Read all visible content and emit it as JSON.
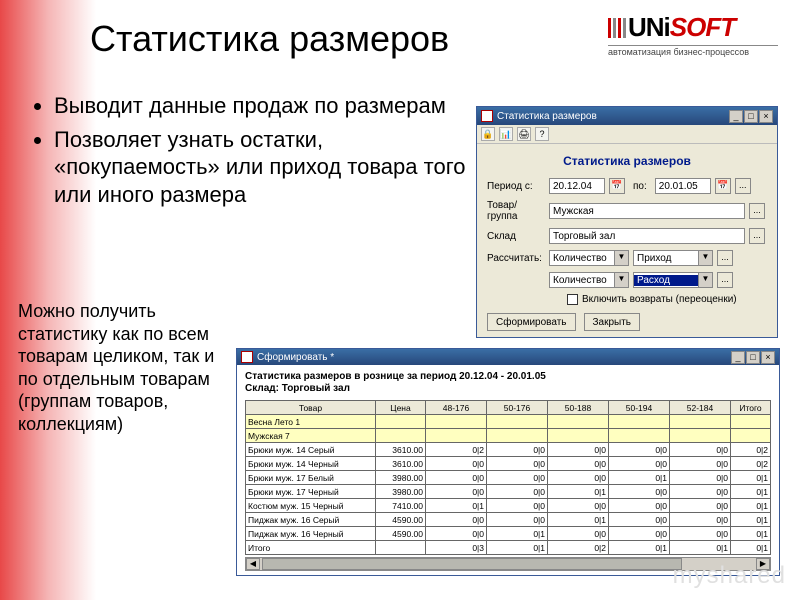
{
  "slide": {
    "title": "Статистика размеров",
    "bullets": [
      "Выводит данные продаж по размерам",
      "Позволяет узнать остатки, «покупаемость» или приход товара того или иного размера"
    ],
    "paragraph": "Можно получить статистику как по всем товарам целиком, так и по отдельным товарам (группам товаров, коллекциям)"
  },
  "logo": {
    "uni": "UNi",
    "soft": "SOFT",
    "sub": "автоматизация бизнес-процессов"
  },
  "watermark": "myshared",
  "dialog": {
    "title": "Статистика размеров",
    "heading": "Статистика размеров",
    "period_label": "Период с:",
    "date_from": "20.12.04",
    "to_label": "по:",
    "date_to": "20.01.05",
    "group_label": "Товар/группа",
    "group_value": "Мужская",
    "warehouse_label": "Склад",
    "warehouse_value": "Торговый зал",
    "calc_label": "Рассчитать:",
    "calc1": "Количество",
    "calc1b": "Приход",
    "calc2": "Количество",
    "calc2b": "Расход",
    "check_label": "Включить возвраты (переоценки)",
    "btn_form": "Сформировать",
    "btn_close": "Закрыть"
  },
  "result": {
    "title": "Сформировать *",
    "head1": "Статистика размеров в рознице за период 20.12.04 - 20.01.05",
    "head2": "Склад: Торговый зал",
    "columns": [
      "Товар",
      "Цена",
      "48-176",
      "50-176",
      "50-188",
      "50-194",
      "52-184",
      "Итого"
    ],
    "rows": [
      {
        "type": "grp",
        "cells": [
          "Весна Лето 1",
          "",
          "",
          "",
          "",
          "",
          "",
          ""
        ]
      },
      {
        "type": "grp",
        "cells": [
          "Мужская 7",
          "",
          "",
          "",
          "",
          "",
          "",
          ""
        ]
      },
      {
        "type": "data",
        "cells": [
          "Брюки муж. 14 Серый",
          "3610.00",
          "0|2",
          "0|0",
          "0|0",
          "0|0",
          "0|0",
          "0|2"
        ]
      },
      {
        "type": "data",
        "cells": [
          "Брюки муж. 14 Черный",
          "3610.00",
          "0|0",
          "0|0",
          "0|0",
          "0|0",
          "0|0",
          "0|2"
        ]
      },
      {
        "type": "data",
        "cells": [
          "Брюки муж. 17 Белый",
          "3980.00",
          "0|0",
          "0|0",
          "0|0",
          "0|1",
          "0|0",
          "0|1"
        ]
      },
      {
        "type": "data",
        "cells": [
          "Брюки муж. 17 Черный",
          "3980.00",
          "0|0",
          "0|0",
          "0|1",
          "0|0",
          "0|0",
          "0|1"
        ]
      },
      {
        "type": "data",
        "cells": [
          "Костюм муж. 15 Черный",
          "7410.00",
          "0|1",
          "0|0",
          "0|0",
          "0|0",
          "0|0",
          "0|1"
        ]
      },
      {
        "type": "data",
        "cells": [
          "Пиджак муж. 16 Серый",
          "4590.00",
          "0|0",
          "0|0",
          "0|1",
          "0|0",
          "0|0",
          "0|1"
        ]
      },
      {
        "type": "data",
        "cells": [
          "Пиджак муж. 16 Черный",
          "4590.00",
          "0|0",
          "0|1",
          "0|0",
          "0|0",
          "0|0",
          "0|1"
        ]
      },
      {
        "type": "data",
        "cells": [
          "Итого",
          "",
          "0|3",
          "0|1",
          "0|2",
          "0|1",
          "0|1",
          "0|1"
        ]
      }
    ]
  }
}
